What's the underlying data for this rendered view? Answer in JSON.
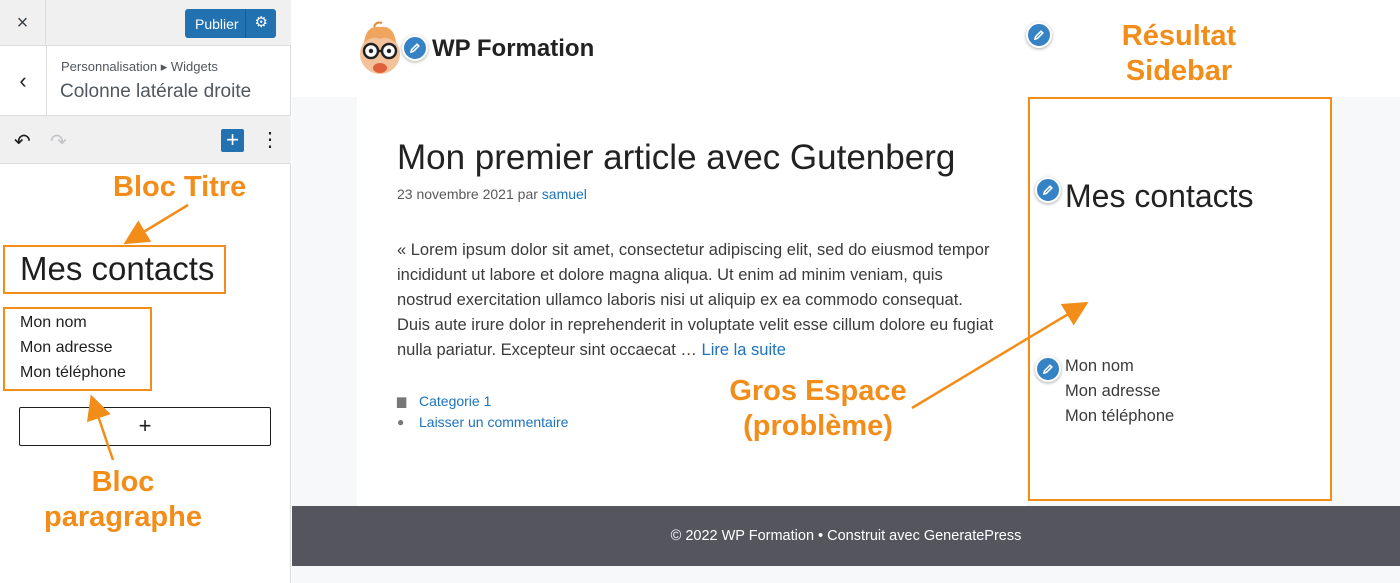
{
  "customizer": {
    "close_icon": "×",
    "publish_label": "Publier",
    "back_icon": "‹",
    "breadcrumb": "Personnalisation ▸ Widgets",
    "section_title": "Colonne latérale droite",
    "undo_icon": "↶",
    "redo_icon": "↷",
    "add_icon": "+",
    "more_icon": "⋮",
    "heading_block": "Mes contacts",
    "paragraph_lines": [
      "Mon nom",
      "Mon adresse",
      "Mon téléphone"
    ],
    "inserter_icon": "+"
  },
  "site": {
    "name": "WP Formation",
    "post": {
      "title": "Mon premier article avec Gutenberg",
      "date": "23 novembre 2021",
      "by": "par",
      "author": "samuel",
      "excerpt": "« Lorem ipsum dolor sit amet, consectetur adipiscing elit, sed do eiusmod tempor incididunt ut labore et dolore magna aliqua. Ut enim ad minim veniam, quis nostrud exercitation ullamco laboris nisi ut aliquip ex ea commodo consequat. Duis aute irure dolor in reprehenderit in voluptate velit esse cillum dolore eu fugiat nulla pariatur. Excepteur sint occaecat …",
      "read_more": "Lire la suite",
      "category": "Categorie 1",
      "comment_link": "Laisser un commentaire"
    },
    "widget": {
      "title": "Mes contacts",
      "lines": [
        "Mon nom",
        "Mon adresse",
        "Mon téléphone"
      ]
    },
    "footer": "© 2022 WP Formation • Construit avec GeneratePress"
  },
  "annotations": {
    "bloc_titre": "Bloc Titre",
    "bloc_paragraphe": [
      "Bloc",
      "paragraphe"
    ],
    "resultat": [
      "Résultat",
      "Sidebar"
    ],
    "gros_espace": [
      "Gros Espace",
      "(problème)"
    ]
  },
  "colors": {
    "accent_orange": "#f28d1a",
    "wp_blue": "#2271b1",
    "link_blue": "#1e73be",
    "footer_bg": "#55555e"
  }
}
